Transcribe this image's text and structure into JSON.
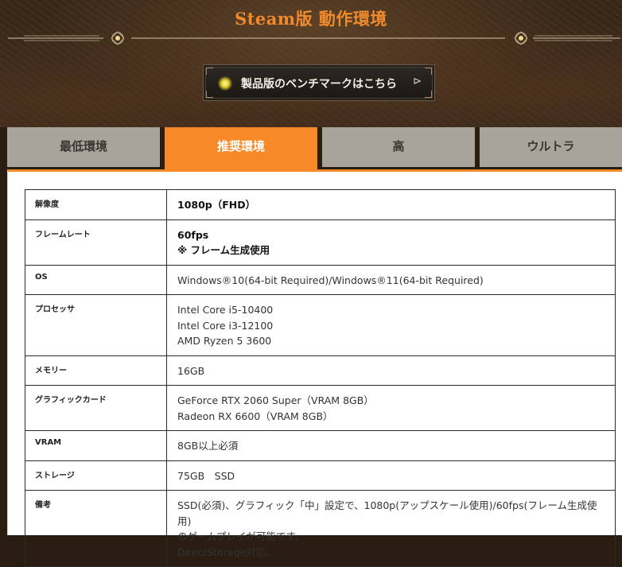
{
  "header": {
    "title": "Steam版 動作環境",
    "benchmark_button": "製品版のベンチマークはこちら",
    "benchmark_arrow": "⊳"
  },
  "tabs": [
    {
      "label": "最低環境",
      "active": false
    },
    {
      "label": "推奨環境",
      "active": true
    },
    {
      "label": "高",
      "active": false
    },
    {
      "label": "ウルトラ",
      "active": false
    }
  ],
  "specs": {
    "resolution": {
      "label": "解像度",
      "lines": [
        "1080p（FHD）"
      ]
    },
    "framerate": {
      "label": "フレームレート",
      "lines": [
        "60fps",
        "※ フレーム生成使用"
      ]
    },
    "os": {
      "label": "OS",
      "lines": [
        "Windows®10(64-bit Required)/Windows®11(64-bit Required)"
      ]
    },
    "processor": {
      "label": "プロセッサ",
      "lines": [
        "Intel Core i5-10400",
        "Intel Core i3-12100",
        "AMD Ryzen 5 3600"
      ]
    },
    "memory": {
      "label": "メモリー",
      "lines": [
        "16GB"
      ]
    },
    "graphics": {
      "label": "グラフィックカード",
      "lines": [
        "GeForce RTX 2060 Super（VRAM 8GB）",
        "Radeon RX 6600（VRAM 8GB）"
      ]
    },
    "vram": {
      "label": "VRAM",
      "lines": [
        "8GB以上必須"
      ]
    },
    "storage": {
      "label": "ストレージ",
      "lines": [
        "75GB　SSD"
      ]
    },
    "notes": {
      "label": "備考",
      "lines": [
        "SSD(必須)、グラフィック「中」設定で、1080p(アップスケール使用)/60fps(フレーム生成使用)",
        "のゲームプレイが可能です。",
        "DirectStorage対応。"
      ]
    }
  },
  "colors": {
    "accent": "#f68a28",
    "tab_inactive": "#a8a39b",
    "title": "#f08a2c"
  }
}
